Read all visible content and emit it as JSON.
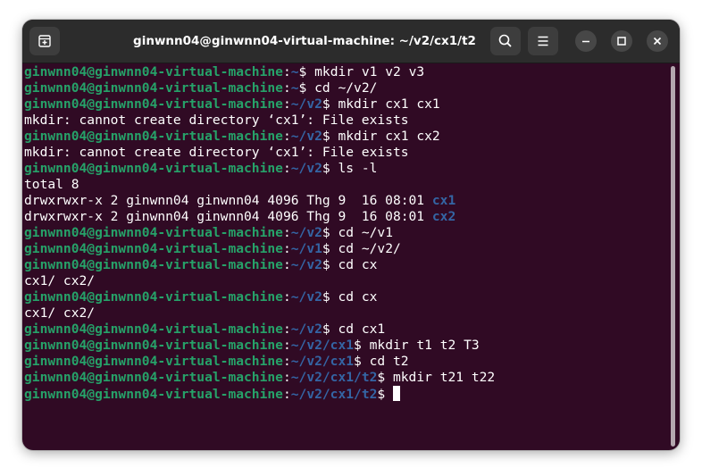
{
  "window": {
    "title": "ginwnn04@ginwnn04-virtual-machine: ~/v2/cx1/t2"
  },
  "icons": {
    "new_tab": "new-tab-icon",
    "search": "search-icon",
    "menu": "hamburger-menu-icon",
    "minimize": "minimize-icon",
    "maximize": "maximize-icon",
    "close": "close-icon"
  },
  "colors": {
    "background": "#300a24",
    "prompt_user": "#26a269",
    "prompt_path": "#3465a4",
    "text": "#ffffff"
  },
  "terminal": {
    "lines": [
      {
        "type": "prompt",
        "user": "ginwnn04@ginwnn04-virtual-machine",
        "path": "~",
        "cmd": " mkdir v1 v2 v3"
      },
      {
        "type": "prompt",
        "user": "ginwnn04@ginwnn04-virtual-machine",
        "path": "~",
        "cmd": " cd ~/v2/"
      },
      {
        "type": "prompt",
        "user": "ginwnn04@ginwnn04-virtual-machine",
        "path": "~/v2",
        "cmd": " mkdir cx1 cx1"
      },
      {
        "type": "output",
        "text": "mkdir: cannot create directory ‘cx1’: File exists"
      },
      {
        "type": "prompt",
        "user": "ginwnn04@ginwnn04-virtual-machine",
        "path": "~/v2",
        "cmd": " mkdir cx1 cx2"
      },
      {
        "type": "output",
        "text": "mkdir: cannot create directory ‘cx1’: File exists"
      },
      {
        "type": "prompt",
        "user": "ginwnn04@ginwnn04-virtual-machine",
        "path": "~/v2",
        "cmd": " ls -l"
      },
      {
        "type": "output",
        "text": "total 8"
      },
      {
        "type": "listing",
        "text": "drwxrwxr-x 2 ginwnn04 ginwnn04 4096 Thg 9  16 08:01 ",
        "name": "cx1"
      },
      {
        "type": "listing",
        "text": "drwxrwxr-x 2 ginwnn04 ginwnn04 4096 Thg 9  16 08:01 ",
        "name": "cx2"
      },
      {
        "type": "prompt",
        "user": "ginwnn04@ginwnn04-virtual-machine",
        "path": "~/v2",
        "cmd": " cd ~/v1"
      },
      {
        "type": "prompt",
        "user": "ginwnn04@ginwnn04-virtual-machine",
        "path": "~/v1",
        "cmd": " cd ~/v2/"
      },
      {
        "type": "prompt",
        "user": "ginwnn04@ginwnn04-virtual-machine",
        "path": "~/v2",
        "cmd": " cd cx"
      },
      {
        "type": "output",
        "text": "cx1/ cx2/"
      },
      {
        "type": "prompt",
        "user": "ginwnn04@ginwnn04-virtual-machine",
        "path": "~/v2",
        "cmd": " cd cx"
      },
      {
        "type": "output",
        "text": "cx1/ cx2/"
      },
      {
        "type": "prompt",
        "user": "ginwnn04@ginwnn04-virtual-machine",
        "path": "~/v2",
        "cmd": " cd cx1"
      },
      {
        "type": "prompt",
        "user": "ginwnn04@ginwnn04-virtual-machine",
        "path": "~/v2/cx1",
        "cmd": " mkdir t1 t2 T3"
      },
      {
        "type": "prompt",
        "user": "ginwnn04@ginwnn04-virtual-machine",
        "path": "~/v2/cx1",
        "cmd": " cd t2"
      },
      {
        "type": "prompt",
        "user": "ginwnn04@ginwnn04-virtual-machine",
        "path": "~/v2/cx1/t2",
        "cmd": " mkdir t21 t22"
      },
      {
        "type": "prompt",
        "user": "ginwnn04@ginwnn04-virtual-machine",
        "path": "~/v2/cx1/t2",
        "cmd": " ",
        "cursor": true
      }
    ]
  }
}
